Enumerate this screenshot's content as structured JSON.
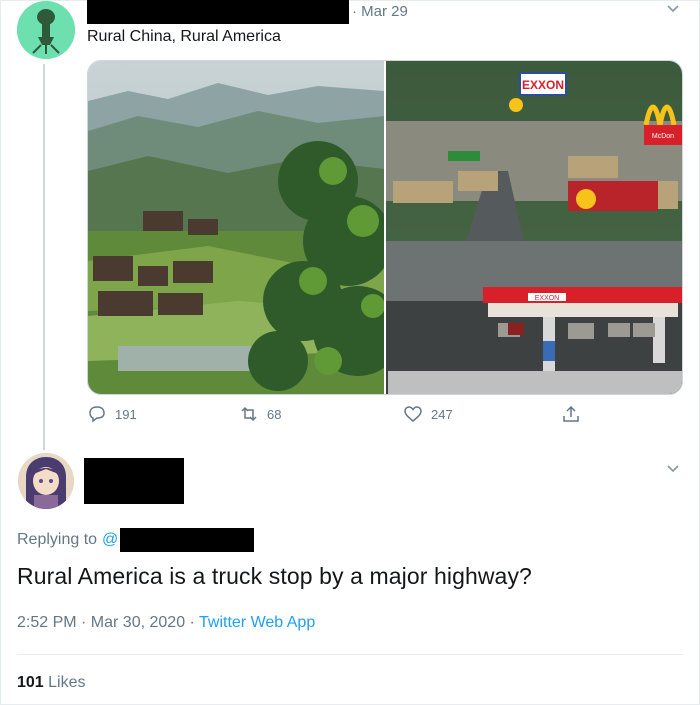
{
  "tweet": {
    "date": "· Mar 29",
    "text": "Rural China, Rural America",
    "counts": {
      "replies": "191",
      "retweets": "68",
      "likes": "247"
    },
    "image_signs": {
      "exxon": "EXXON",
      "mcdonalds": "McDon"
    },
    "icons": [
      "chevron-down-icon",
      "reply-icon",
      "retweet-icon",
      "like-icon",
      "share-icon"
    ]
  },
  "reply": {
    "replying_label": "Replying to",
    "replying_handle": "@",
    "text": "Rural America is a truck stop by a major highway?",
    "time": "2:52 PM · Mar 30, 2020 · ",
    "source": "Twitter Web App",
    "likes_count": "101",
    "likes_label": "Likes"
  },
  "colors": {
    "accent": "#1da1f2",
    "muted": "#657786",
    "text": "#14171a"
  }
}
